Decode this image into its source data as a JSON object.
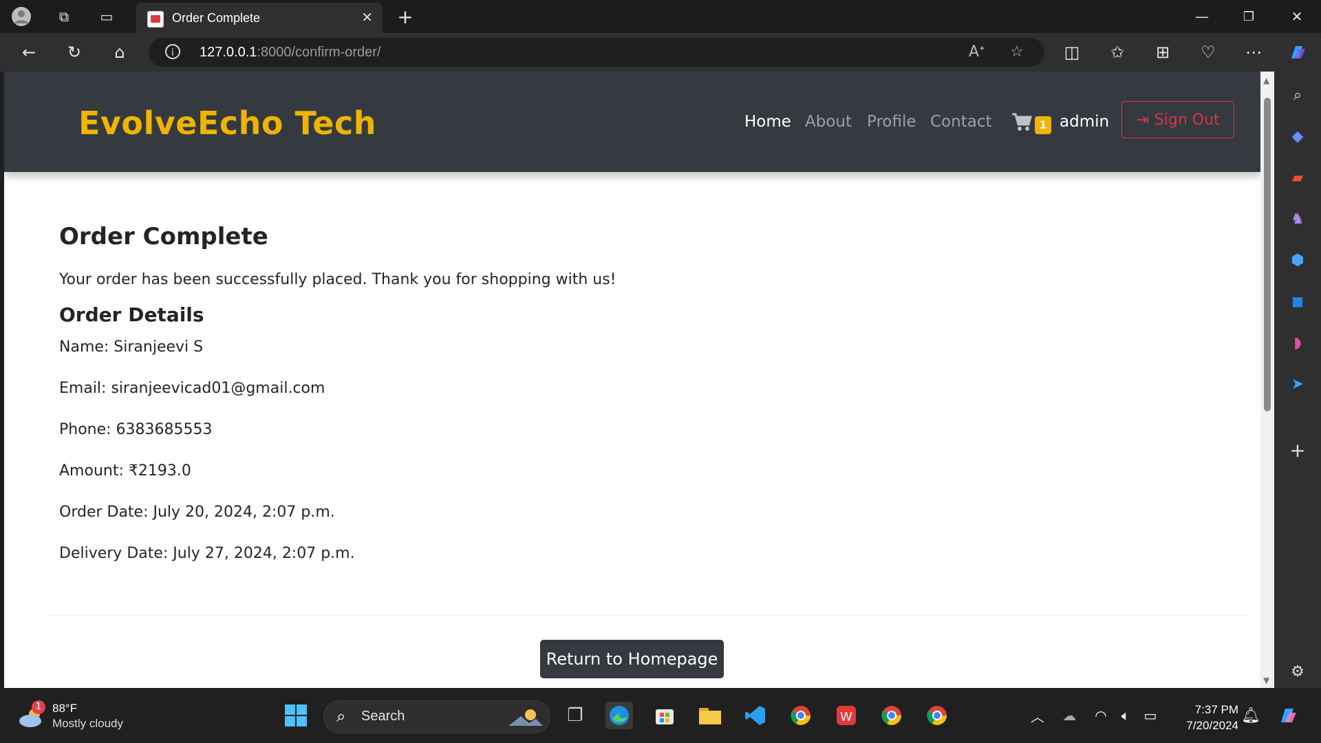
{
  "browser": {
    "tab_title": "Order Complete",
    "url_host": "127.0.0.1",
    "url_path": ":8000/confirm-order/"
  },
  "site": {
    "brand": "EvolveEcho Tech",
    "nav": [
      {
        "label": "Home",
        "active": true
      },
      {
        "label": "About",
        "active": false
      },
      {
        "label": "Profile",
        "active": false
      },
      {
        "label": "Contact",
        "active": false
      }
    ],
    "cart_count": "1",
    "username": "admin",
    "signout_label": "Sign Out"
  },
  "order": {
    "heading": "Order Complete",
    "message": "Your order has been successfully placed. Thank you for shopping with us!",
    "details_heading": "Order Details",
    "details": [
      "Name: Siranjeevi S",
      "Email: siranjeevicad01@gmail.com",
      "Phone: 6383685553",
      "Amount: ₹2193.0",
      "Order Date: July 20, 2024, 2:07 p.m.",
      "Delivery Date: July 27, 2024, 2:07 p.m."
    ],
    "return_button": "Return to Homepage"
  },
  "taskbar": {
    "weather_temp": "88°F",
    "weather_desc": "Mostly cloudy",
    "weather_badge": "1",
    "search_label": "Search",
    "time": "7:37 PM",
    "date": "7/20/2024"
  },
  "colors": {
    "brand": "#f0b400",
    "navbar": "#343a40",
    "danger": "#dc3545"
  }
}
